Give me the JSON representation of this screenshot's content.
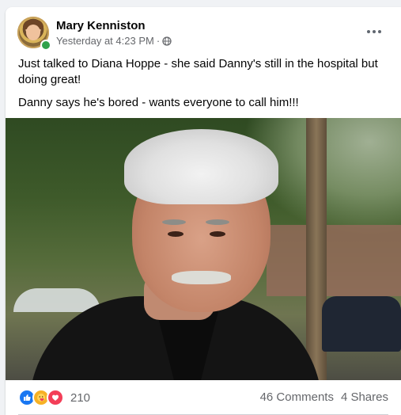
{
  "post": {
    "author": "Mary Kenniston",
    "timestamp": "Yesterday at 4:23 PM",
    "separator": "·",
    "audience_icon": "globe-icon",
    "more_icon": "more-options-icon",
    "paragraphs": [
      "Just talked to Diana Hoppe - she said Danny's still in the hospital but doing great!",
      "Danny says he's bored - wants everyone to call him!!!"
    ]
  },
  "reactions": {
    "icons": [
      "like-icon",
      "care-icon",
      "love-icon"
    ],
    "count": "210"
  },
  "stats": {
    "comments": "46 Comments",
    "shares": "4 Shares"
  },
  "colors": {
    "like": "#1877f2",
    "care": "#f7b125",
    "love": "#f33e58",
    "online": "#31a24c",
    "secondary_text": "#65676b"
  }
}
